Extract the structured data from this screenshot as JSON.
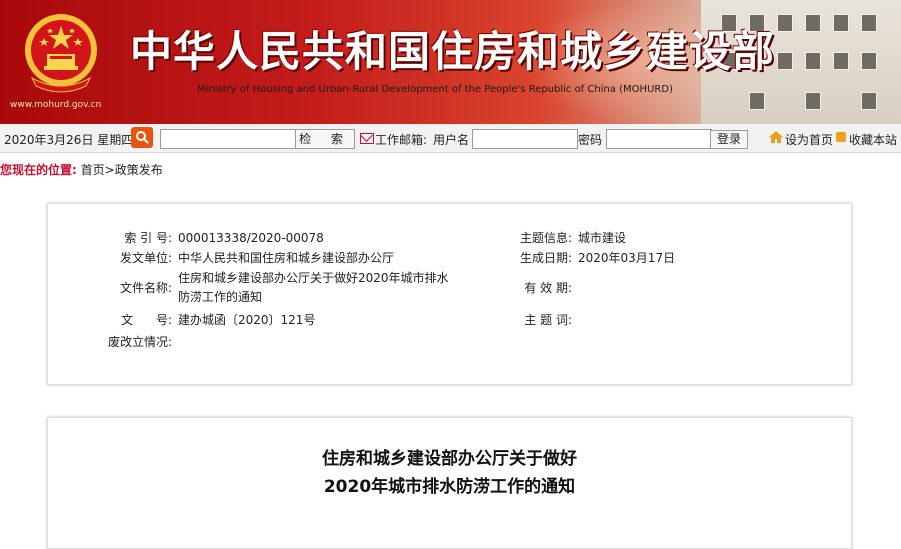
{
  "header": {
    "title": "中华人民共和国住房和城乡建设部",
    "subtitle": "Ministry of Housing and Urban-Rural Development of the People's Republic of China (MOHURD)",
    "url": "www.mohurd.gov.cn",
    "emblem_icon": "national-emblem-icon"
  },
  "toolbar": {
    "date": "2020年3月26日 星期四",
    "search_icon": "search-icon",
    "search_placeholder": "",
    "search_button": "检 索",
    "mail_label": "工作邮箱:",
    "username_label": "用户名",
    "password_label": "密码",
    "login_button": "登录",
    "set_home": "设为首页",
    "bookmark": "收藏本站"
  },
  "breadcrumb": {
    "label": "您现在的位置:",
    "home": "首页",
    "separator": ">",
    "current": "政策发布"
  },
  "info": {
    "index_label": "索 引 号:",
    "index_value": "000013338/2020-00078",
    "subject_label": "主题信息:",
    "subject_value": "城市建设",
    "issuer_label": "发文单位:",
    "issuer_value": "中华人民共和国住房和城乡建设部办公厅",
    "date_label": "生成日期:",
    "date_value": "2020年03月17日",
    "docname_label": "文件名称:",
    "docname_line1": "住房和城乡建设部办公厅关于做好2020年城市排水",
    "docname_line2": "防涝工作的通知",
    "validity_label": "有 效 期:",
    "validity_value": "",
    "docno_label": "文      号:",
    "docno_value": "建办城函〔2020〕121号",
    "keywords_label": "主 题 词:",
    "keywords_value": "",
    "status_label": "废改立情况:",
    "status_value": ""
  },
  "notice": {
    "title_line1": "住房和城乡建设部办公厅关于做好",
    "title_line2": "2020年城市排水防涝工作的通知"
  },
  "colors": {
    "banner_red": "#c41d1b",
    "accent_red": "#c8102e",
    "search_orange": "#e8530f"
  }
}
